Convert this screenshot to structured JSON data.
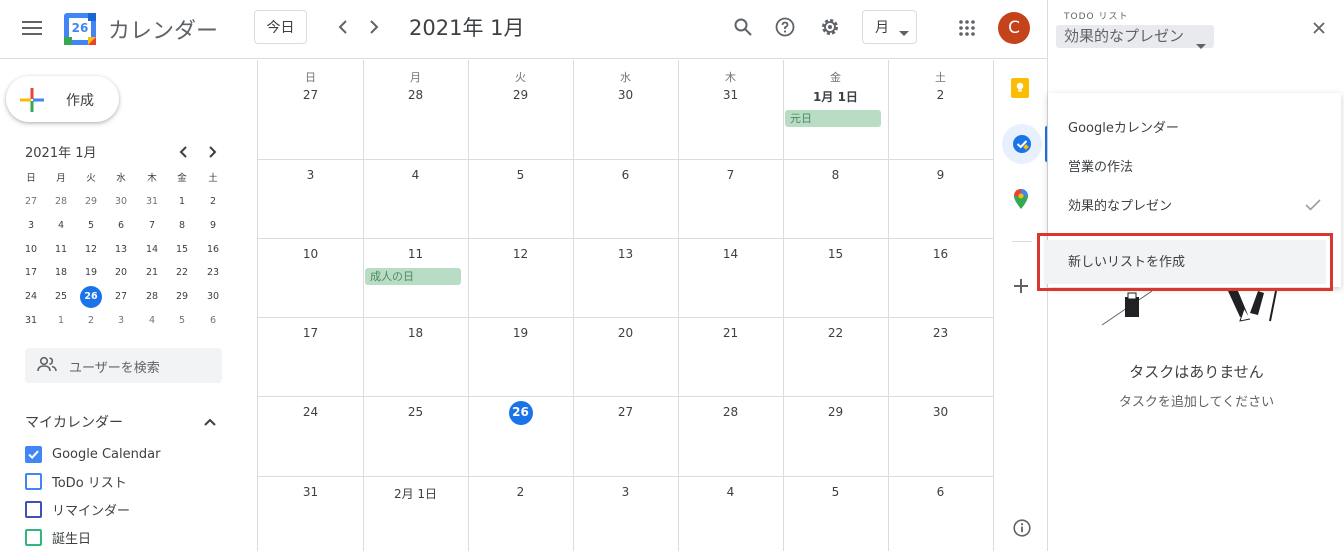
{
  "header": {
    "app_title": "カレンダー",
    "logo_day": "26",
    "today_label": "今日",
    "date_title": "2021年 1月",
    "view_label": "月",
    "avatar_letter": "C"
  },
  "sidebar": {
    "create_label": "作成",
    "mini_title": "2021年 1月",
    "mini_dows": [
      "日",
      "月",
      "火",
      "水",
      "木",
      "金",
      "土"
    ],
    "mini_weeks": [
      [
        "27",
        "28",
        "29",
        "30",
        "31",
        "1",
        "2"
      ],
      [
        "3",
        "4",
        "5",
        "6",
        "7",
        "8",
        "9"
      ],
      [
        "10",
        "11",
        "12",
        "13",
        "14",
        "15",
        "16"
      ],
      [
        "17",
        "18",
        "19",
        "20",
        "21",
        "22",
        "23"
      ],
      [
        "24",
        "25",
        "26",
        "27",
        "28",
        "29",
        "30"
      ],
      [
        "31",
        "1",
        "2",
        "3",
        "4",
        "5",
        "6"
      ]
    ],
    "search_users_placeholder": "ユーザーを検索",
    "my_calendars_title": "マイカレンダー",
    "calendars": [
      {
        "label": "Google Calendar",
        "color": "#4285f4",
        "checked": true
      },
      {
        "label": "ToDo リスト",
        "color": "#4285f4",
        "checked": false
      },
      {
        "label": "リマインダー",
        "color": "#3f51b5",
        "checked": false
      },
      {
        "label": "誕生日",
        "color": "#33b679",
        "checked": false
      }
    ]
  },
  "grid": {
    "dows": [
      "日",
      "月",
      "火",
      "水",
      "木",
      "金",
      "土"
    ],
    "weeks": [
      [
        "27",
        "28",
        "29",
        "30",
        "31",
        "1月 1日",
        "2"
      ],
      [
        "3",
        "4",
        "5",
        "6",
        "7",
        "8",
        "9"
      ],
      [
        "10",
        "11",
        "12",
        "13",
        "14",
        "15",
        "16"
      ],
      [
        "17",
        "18",
        "19",
        "20",
        "21",
        "22",
        "23"
      ],
      [
        "24",
        "25",
        "26",
        "27",
        "28",
        "29",
        "30"
      ],
      [
        "31",
        "2月 1日",
        "2",
        "3",
        "4",
        "5",
        "6"
      ]
    ],
    "events": [
      {
        "label": "元日"
      },
      {
        "label": "成人の日"
      }
    ]
  },
  "tasks": {
    "kicker": "TODO リスト",
    "current_list": "効果的なプレゼン",
    "menu_items": [
      "Googleカレンダー",
      "営業の作法",
      "効果的なプレゼン"
    ],
    "new_list_label": "新しいリストを作成",
    "empty_title": "タスクはありません",
    "empty_sub": "タスクを追加してください"
  },
  "colors": {
    "accent": "#1a73e8",
    "event_green": "#b9dcc5",
    "highlight_red": "#d9362e",
    "avatar": "#c5431a"
  }
}
